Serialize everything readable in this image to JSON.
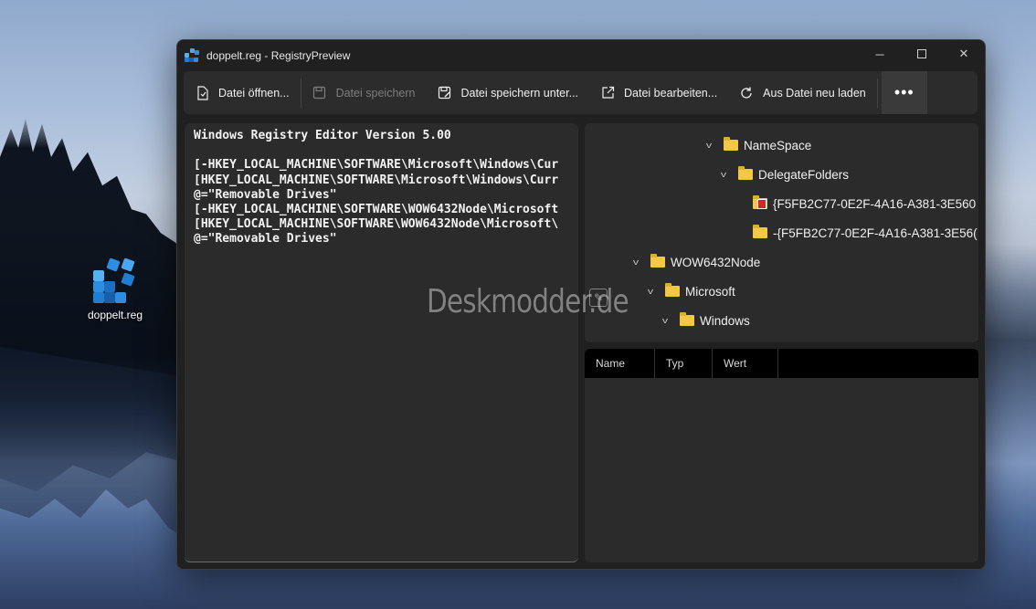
{
  "desktop": {
    "icon_label": "doppelt.reg"
  },
  "window": {
    "title": "doppelt.reg - RegistryPreview",
    "controls": {
      "minimize": "─",
      "close": "✕"
    }
  },
  "toolbar": {
    "open_label": "Datei öffnen...",
    "save_label": "Datei speichern",
    "save_as_label": "Datei speichern unter...",
    "edit_label": "Datei bearbeiten...",
    "reload_label": "Aus Datei neu laden",
    "more_label": "•••"
  },
  "editor": {
    "text": "Windows Registry Editor Version 5.00\n\n[-HKEY_LOCAL_MACHINE\\SOFTWARE\\Microsoft\\Windows\\Cur\n[HKEY_LOCAL_MACHINE\\SOFTWARE\\Microsoft\\Windows\\Curr\n@=\"Removable Drives\"\n[-HKEY_LOCAL_MACHINE\\SOFTWARE\\WOW6432Node\\Microsoft\n[HKEY_LOCAL_MACHINE\\SOFTWARE\\WOW6432Node\\Microsoft\\\n@=\"Removable Drives\""
  },
  "tree": {
    "items": [
      {
        "label": "NameSpace",
        "expanded": true
      },
      {
        "label": "DelegateFolders",
        "expanded": true
      },
      {
        "label": "{F5FB2C77-0E2F-4A16-A381-3E560",
        "deleted": true
      },
      {
        "label": "-{F5FB2C77-0E2F-4A16-A381-3E56(",
        "deleted": false
      },
      {
        "label": "WOW6432Node",
        "expanded": true
      },
      {
        "label": "Microsoft",
        "expanded": true
      },
      {
        "label": "Windows",
        "expanded": true
      }
    ]
  },
  "values_table": {
    "columns": [
      "Name",
      "Typ",
      "Wert"
    ]
  },
  "watermark": {
    "text": "Deskmodder.de"
  },
  "colors": {
    "window_bg": "#202020",
    "panel_bg": "#2b2b2b",
    "folder": "#f3c748",
    "deleted_badge": "#d32626"
  }
}
